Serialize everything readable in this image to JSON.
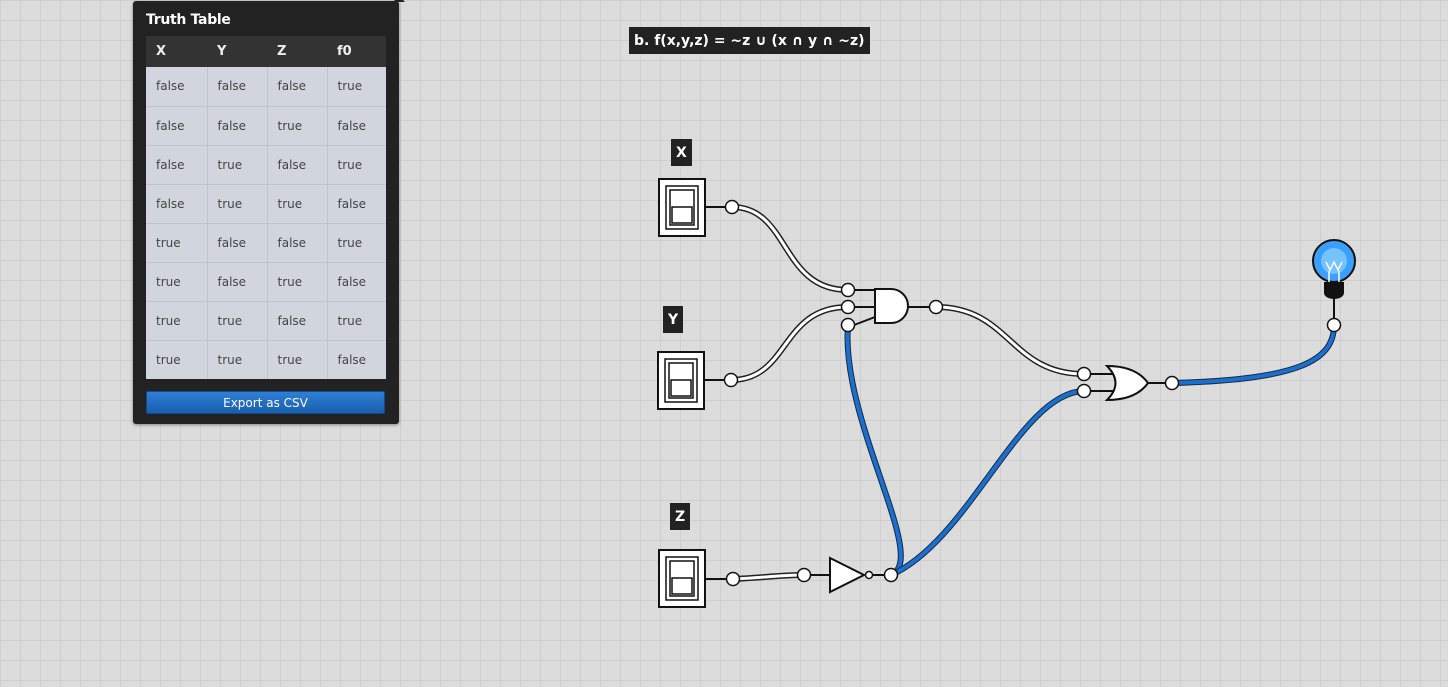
{
  "truth_table": {
    "title": "Truth Table",
    "columns": [
      "X",
      "Y",
      "Z",
      "f0"
    ],
    "rows": [
      [
        "false",
        "false",
        "false",
        "true"
      ],
      [
        "false",
        "false",
        "true",
        "false"
      ],
      [
        "false",
        "true",
        "false",
        "true"
      ],
      [
        "false",
        "true",
        "true",
        "false"
      ],
      [
        "true",
        "false",
        "false",
        "true"
      ],
      [
        "true",
        "false",
        "true",
        "false"
      ],
      [
        "true",
        "true",
        "false",
        "true"
      ],
      [
        "true",
        "true",
        "true",
        "false"
      ]
    ],
    "export_label": "Export as CSV"
  },
  "circuit": {
    "formula": "b. f(x,y,z) = ~z ∪ (x ∩ y ∩ ~z)",
    "switch_labels": {
      "x": "X",
      "y": "Y",
      "z": "Z"
    },
    "gates": [
      "and-gate",
      "or-gate",
      "not-gate"
    ],
    "output": "light-bulb",
    "colors": {
      "active_wire": "#1a6fd0",
      "inactive_wire": "#ffffff",
      "bulb_on": "#3aa0ff"
    }
  }
}
